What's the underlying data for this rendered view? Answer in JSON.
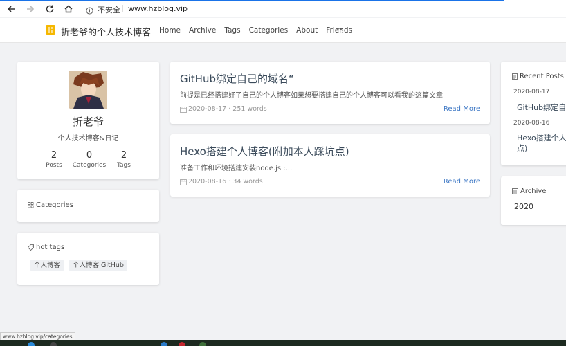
{
  "browser": {
    "insecure_label": "不安全",
    "separator": "|",
    "url": "www.hzblog.vip"
  },
  "site": {
    "title": "折老爷的个人技术博客",
    "menu": [
      "Home",
      "Archive",
      "Tags",
      "Categories",
      "About",
      "Friends"
    ]
  },
  "profile": {
    "name": "折老爷",
    "description": "个人技术博客&日记",
    "stats": [
      {
        "value": "2",
        "label": "Posts"
      },
      {
        "value": "0",
        "label": "Categories"
      },
      {
        "value": "2",
        "label": "Tags"
      }
    ]
  },
  "categories_card": {
    "title": "Categories"
  },
  "tags_card": {
    "title": "hot tags",
    "tags": [
      "个人博客",
      "个人博客 GitHub"
    ]
  },
  "posts": [
    {
      "title": "GitHub绑定自己的域名“",
      "excerpt": "前提是已经搭建好了自己的个人博客如果想要搭建自己的个人博客可以看我的这篇文章",
      "meta": "2020-08-17 · 251 words",
      "read_more": "Read More"
    },
    {
      "title": "Hexo搭建个人博客(附加本人踩坑点)",
      "excerpt": "准备工作和环境搭建安装node.js :...",
      "meta": "2020-08-16 · 34 words",
      "read_more": "Read More"
    }
  ],
  "recent_posts": {
    "title": "Recent Posts",
    "items": [
      {
        "date": "2020-08-17",
        "title": "GitHub绑定自"
      },
      {
        "date": "2020-08-16",
        "title": "Hexo搭建个人点)"
      }
    ]
  },
  "archive": {
    "title": "Archive",
    "years": [
      "2020"
    ]
  },
  "status_bar": {
    "url": "www.hzblog.vip/categories"
  },
  "colors": {
    "accent": "#3b76c4",
    "background": "#f1f2f4",
    "loadbar": "#1a73e8"
  }
}
